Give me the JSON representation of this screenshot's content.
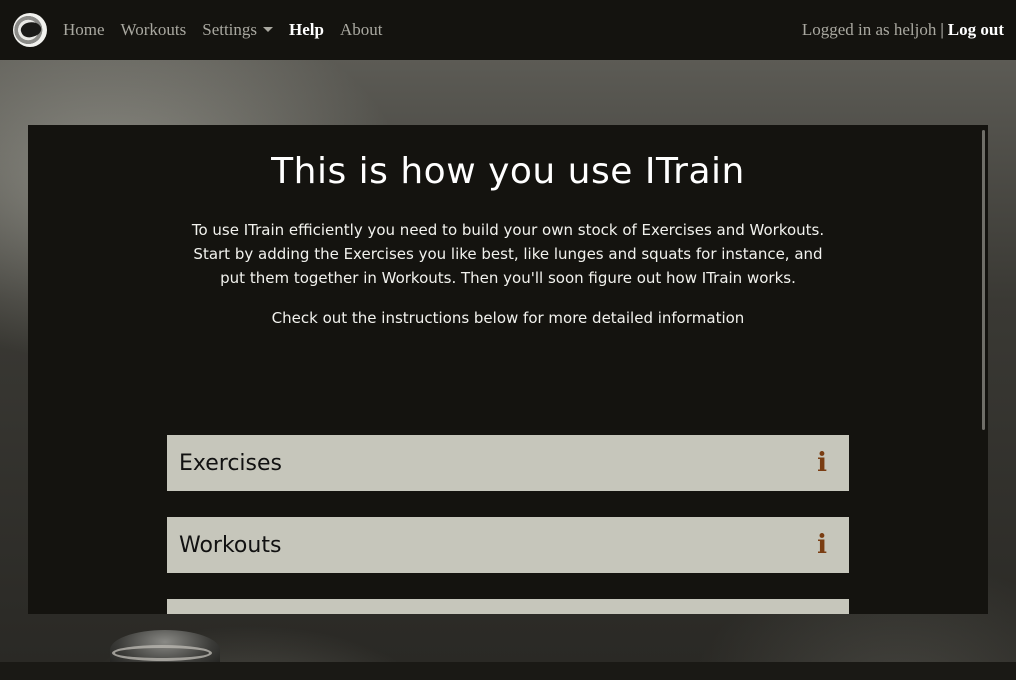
{
  "nav": {
    "home": "Home",
    "workouts": "Workouts",
    "settings": "Settings",
    "help": "Help",
    "about": "About",
    "logged_in": "Logged in as heljoh",
    "separator": "|",
    "logout": "Log out"
  },
  "main": {
    "title": "This is how you use ITrain",
    "intro_line1": "To use ITrain efficiently you need to build your own stock of Exercises and Workouts.",
    "intro_line2": "Start by adding the Exercises you like best, like lunges and squats for instance, and put them together in Workouts. Then you'll soon figure out how ITrain works.",
    "instructions": "Check out the instructions below for more detailed information",
    "sections": [
      {
        "label": "Exercises",
        "icon": "info-icon",
        "icon_glyph": "i"
      },
      {
        "label": "Workouts",
        "icon": "info-icon",
        "icon_glyph": "i"
      }
    ]
  },
  "colors": {
    "navbar_bg": "#14130f",
    "panel_bg": "#14130f",
    "section_bg": "#c6c6bb",
    "info_icon": "#7a3d12"
  }
}
